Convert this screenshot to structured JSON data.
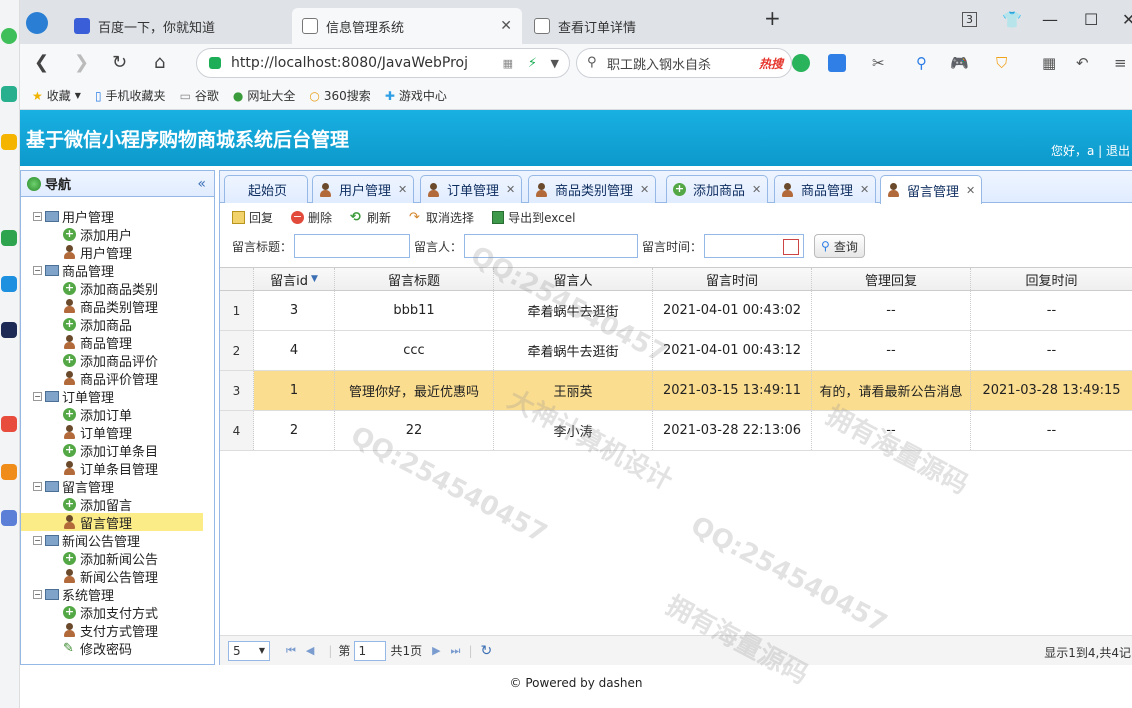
{
  "browser": {
    "tabs": [
      {
        "label": "百度一下，你就知道"
      },
      {
        "label": "信息管理系统"
      },
      {
        "label": "查看订单详情"
      }
    ],
    "tab_count": "3",
    "url": "http://localhost:8080/JavaWebProj",
    "search_text": "职工跳入钢水自杀",
    "hot_label": "热搜",
    "bookmarks": [
      "收藏",
      "手机收藏夹",
      "谷歌",
      "网址大全",
      "360搜索",
      "游戏中心"
    ]
  },
  "app": {
    "title": "基于微信小程序购物商城系统后台管理",
    "greeting": "您好，a | 退出"
  },
  "nav": {
    "title": "导航",
    "groups": [
      {
        "label": "用户管理",
        "items": [
          {
            "label": "添加用户",
            "icon": "add"
          },
          {
            "label": "用户管理",
            "icon": "user"
          }
        ]
      },
      {
        "label": "商品管理",
        "items": [
          {
            "label": "添加商品类别",
            "icon": "add"
          },
          {
            "label": "商品类别管理",
            "icon": "user"
          },
          {
            "label": "添加商品",
            "icon": "add"
          },
          {
            "label": "商品管理",
            "icon": "user"
          },
          {
            "label": "添加商品评价",
            "icon": "add"
          },
          {
            "label": "商品评价管理",
            "icon": "user"
          }
        ]
      },
      {
        "label": "订单管理",
        "items": [
          {
            "label": "添加订单",
            "icon": "add"
          },
          {
            "label": "订单管理",
            "icon": "user"
          },
          {
            "label": "添加订单条目",
            "icon": "add"
          },
          {
            "label": "订单条目管理",
            "icon": "user"
          }
        ]
      },
      {
        "label": "留言管理",
        "items": [
          {
            "label": "添加留言",
            "icon": "add"
          },
          {
            "label": "留言管理",
            "icon": "user",
            "selected": true
          }
        ]
      },
      {
        "label": "新闻公告管理",
        "items": [
          {
            "label": "添加新闻公告",
            "icon": "add"
          },
          {
            "label": "新闻公告管理",
            "icon": "user"
          }
        ]
      },
      {
        "label": "系统管理",
        "items": [
          {
            "label": "添加支付方式",
            "icon": "add"
          },
          {
            "label": "支付方式管理",
            "icon": "user"
          },
          {
            "label": "修改密码",
            "icon": "pen"
          }
        ]
      }
    ]
  },
  "tabs": [
    {
      "label": "起始页",
      "closable": false
    },
    {
      "label": "用户管理",
      "closable": true
    },
    {
      "label": "订单管理",
      "closable": true
    },
    {
      "label": "商品类别管理",
      "closable": true
    },
    {
      "label": "添加商品",
      "closable": true
    },
    {
      "label": "商品管理",
      "closable": true
    },
    {
      "label": "留言管理",
      "closable": true,
      "active": true
    }
  ],
  "toolbar": {
    "edit": "回复",
    "delete": "删除",
    "refresh": "刷新",
    "unselect": "取消选择",
    "export": "导出到excel"
  },
  "filters": {
    "title_label": "留言标题：",
    "author_label": "留言人：",
    "time_label": "留言时间：",
    "query_button": "查询"
  },
  "grid": {
    "columns": [
      "留言id",
      "留言标题",
      "留言人",
      "留言时间",
      "管理回复",
      "回复时间"
    ],
    "rows": [
      {
        "rn": "1",
        "cells": [
          "3",
          "bbb11",
          "牵着蜗牛去逛街",
          "2021-04-01 00:43:02",
          "--",
          "--"
        ]
      },
      {
        "rn": "2",
        "cells": [
          "4",
          "ccc",
          "牵着蜗牛去逛街",
          "2021-04-01 00:43:12",
          "--",
          "--"
        ]
      },
      {
        "rn": "3",
        "cells": [
          "1",
          "管理你好，最近优惠吗",
          "王丽英",
          "2021-03-15 13:49:11",
          "有的，请看最新公告消息",
          "2021-03-28 13:49:15"
        ],
        "highlight": true
      },
      {
        "rn": "4",
        "cells": [
          "2",
          "22",
          "李小涛",
          "2021-03-28 22:13:06",
          "--",
          "--"
        ]
      }
    ]
  },
  "pager": {
    "page_size": "5",
    "page_prefix": "第",
    "page_value": "1",
    "page_total": "共1页",
    "info": "显示1到4,共4记"
  },
  "footer": "© Powered by dashen",
  "watermarks": [
    "QQ:254540457",
    "大神计算机设计",
    "拥有海量源码"
  ]
}
